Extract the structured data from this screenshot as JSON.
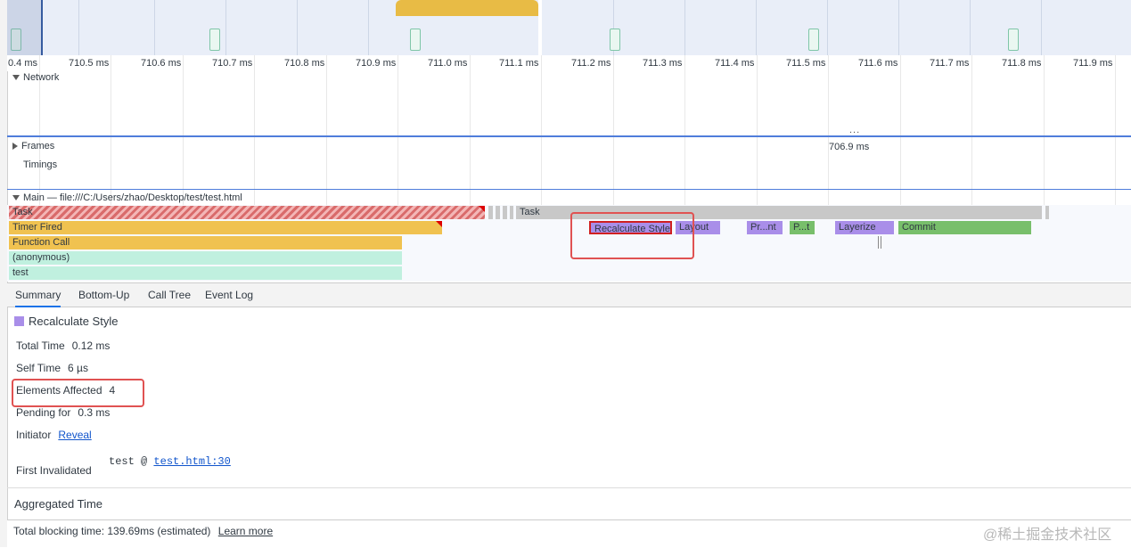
{
  "ruler": {
    "ticks": [
      "0.4 ms",
      "710.5 ms",
      "710.6 ms",
      "710.7 ms",
      "710.8 ms",
      "710.9 ms",
      "711.0 ms",
      "711.1 ms",
      "711.2 ms",
      "711.3 ms",
      "711.4 ms",
      "711.5 ms",
      "711.6 ms",
      "711.7 ms",
      "711.8 ms",
      "711.9 ms"
    ]
  },
  "tracks": {
    "network": "Network",
    "frames": "Frames",
    "frames_time": "706.9 ms",
    "timings": "Timings",
    "main": "Main — file:///C:/Users/zhao/Desktop/test/test.html",
    "resize_handle": "..."
  },
  "flame": {
    "task1": "Task",
    "task2": "Task",
    "timer_fired": "Timer Fired",
    "function_call": "Function Call",
    "anonymous": "(anonymous)",
    "test": "test",
    "recalculate_style": "Recalculate Style",
    "layout": "Layout",
    "paint": "Pr...nt",
    "p_t": "P...t",
    "layerize": "Layerize",
    "commit": "Commit"
  },
  "colors": {
    "task_gray": "#c8c8c8",
    "scripting_yellow": "#f0c250",
    "js_green": "#c0f0df",
    "rendering_purple": "#a98ee9",
    "painting_green": "#78bf6b",
    "highlight_red": "#e05252"
  },
  "tabs": [
    "Summary",
    "Bottom-Up",
    "Call Tree",
    "Event Log"
  ],
  "summary": {
    "title": "Recalculate Style",
    "total_time_label": "Total Time",
    "total_time_value": "0.12 ms",
    "self_time_label": "Self Time",
    "self_time_value": "6 µs",
    "elements_affected_label": "Elements Affected",
    "elements_affected_value": "4",
    "pending_label": "Pending for",
    "pending_value": "0.3 ms",
    "initiator_label": "Initiator",
    "initiator_link": "Reveal",
    "first_invalidated_label": "First Invalidated",
    "first_invalidated_fn": "test @",
    "first_invalidated_link": "test.html:30",
    "aggregated_title": "Aggregated Time"
  },
  "footer": {
    "text": "Total blocking time: 139.69ms (estimated)",
    "link": "Learn more"
  },
  "watermark": "@稀土掘金技术社区"
}
